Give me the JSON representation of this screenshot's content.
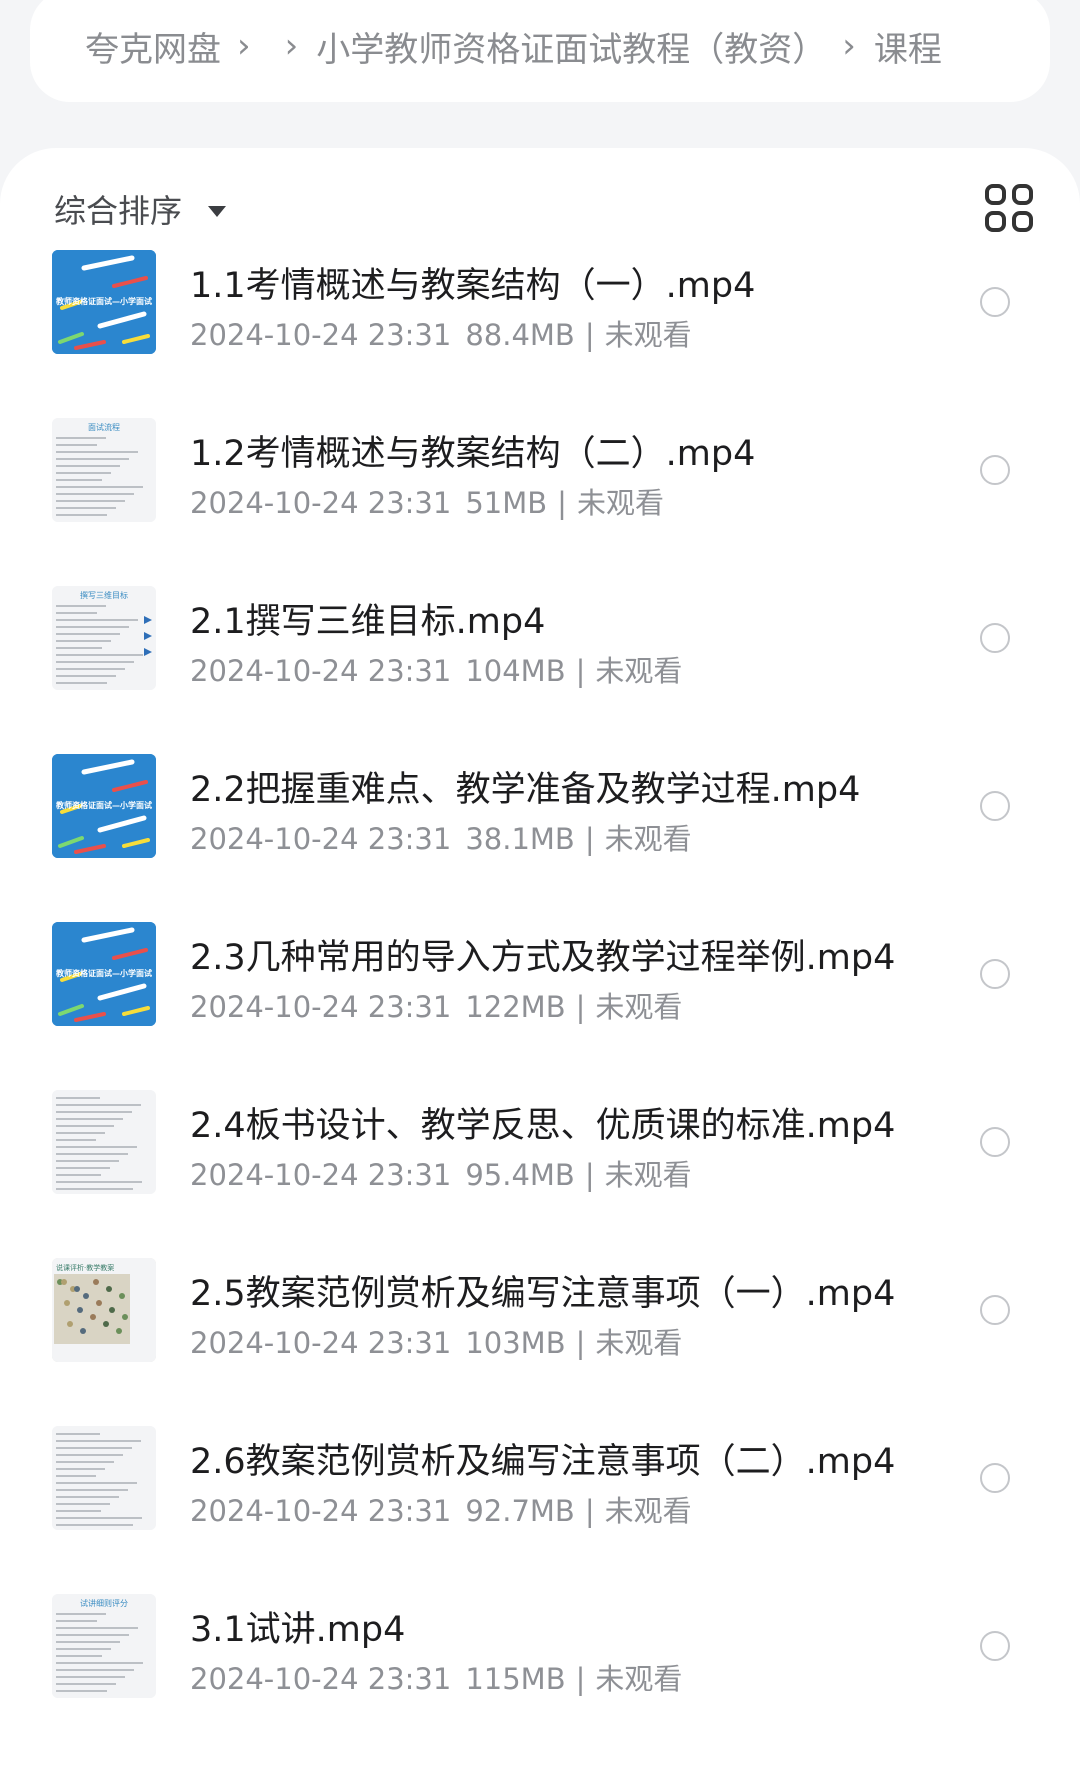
{
  "breadcrumb": {
    "items": [
      "夸克网盘",
      "",
      "小学教师资格证面试教程（教资）",
      "课程"
    ],
    "separator": "›"
  },
  "toolbar": {
    "sort_label": "综合排序",
    "view_toggle_icon": "grid-view-icon"
  },
  "files": [
    {
      "name": "1.1考情概述与教案结构（一）.mp4",
      "date": "2024-10-24 23:31",
      "size": "88.4MB",
      "status": "未观看",
      "thumb": "blue",
      "thumb_text": "教师资格证面试—小学面试"
    },
    {
      "name": "1.2考情概述与教案结构（二）.mp4",
      "date": "2024-10-24 23:31",
      "size": "51MB",
      "status": "未观看",
      "thumb": "doc",
      "thumb_text": "面试流程"
    },
    {
      "name": "2.1撰写三维目标.mp4",
      "date": "2024-10-24 23:31",
      "size": "104MB",
      "status": "未观看",
      "thumb": "table",
      "thumb_text": "撰写三维目标"
    },
    {
      "name": "2.2把握重难点、教学准备及教学过程.mp4",
      "date": "2024-10-24 23:31",
      "size": "38.1MB",
      "status": "未观看",
      "thumb": "blue",
      "thumb_text": "教师资格证面试—小学面试"
    },
    {
      "name": "2.3几种常用的导入方式及教学过程举例.mp4",
      "date": "2024-10-24 23:31",
      "size": "122MB",
      "status": "未观看",
      "thumb": "blue",
      "thumb_text": "教师资格证面试—小学面试"
    },
    {
      "name": "2.4板书设计、教学反思、优质课的标准.mp4",
      "date": "2024-10-24 23:31",
      "size": "95.4MB",
      "status": "未观看",
      "thumb": "doc",
      "thumb_text": ""
    },
    {
      "name": "2.5教案范例赏析及编写注意事项（一）.mp4",
      "date": "2024-10-24 23:31",
      "size": "103MB",
      "status": "未观看",
      "thumb": "photo",
      "thumb_text": "说课评析·教学教案"
    },
    {
      "name": "2.6教案范例赏析及编写注意事项（二）.mp4",
      "date": "2024-10-24 23:31",
      "size": "92.7MB",
      "status": "未观看",
      "thumb": "doc",
      "thumb_text": ""
    },
    {
      "name": "3.1试讲.mp4",
      "date": "2024-10-24 23:31",
      "size": "115MB",
      "status": "未观看",
      "thumb": "doc",
      "thumb_text": "试讲细则评分"
    }
  ],
  "colors": {
    "background": "#f4f5f7",
    "thumb_blue": "#2b86cf",
    "meta_text": "#8e9095",
    "radio_border": "#c4c6ca"
  }
}
